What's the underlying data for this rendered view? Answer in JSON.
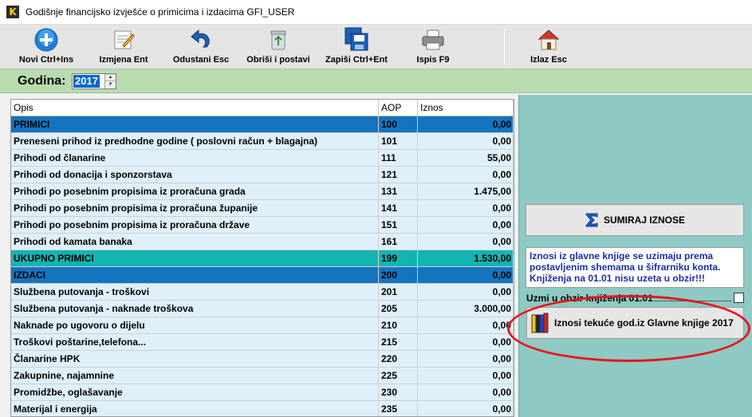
{
  "window": {
    "title": "Godišnje financijsko izvješće o primicima i izdacima GFI_USER",
    "app_icon": "K"
  },
  "toolbar": {
    "new": "Novi Ctrl+Ins",
    "edit": "Izmjena Ent",
    "cancel": "Odustani Esc",
    "delete": "Obriši i postavi",
    "save": "Zapiši Ctrl+Ent",
    "print": "Ispis F9",
    "exit": "Izlaz Esc"
  },
  "year": {
    "label": "Godina:",
    "value": "2017"
  },
  "table": {
    "headers": {
      "opis": "Opis",
      "aop": "AOP",
      "iznos": "Iznos"
    },
    "rows": [
      {
        "opis": "PRIMICI",
        "aop": "100",
        "iznos": "0,00",
        "kind": "section"
      },
      {
        "opis": "Preneseni prihod iz predhodne godine ( poslovni račun + blagajna)",
        "aop": "101",
        "iznos": "0,00",
        "kind": "normal"
      },
      {
        "opis": "Prihodi od članarine",
        "aop": "111",
        "iznos": "55,00",
        "kind": "normal"
      },
      {
        "opis": "Prihodi od donacija i sponzorstava",
        "aop": "121",
        "iznos": "0,00",
        "kind": "normal"
      },
      {
        "opis": "Prihodi po posebnim propisima iz proračuna grada",
        "aop": "131",
        "iznos": "1.475,00",
        "kind": "normal"
      },
      {
        "opis": "Prihodi po posebnim propisima iz proračuna županije",
        "aop": "141",
        "iznos": "0,00",
        "kind": "normal"
      },
      {
        "opis": "Prihodi po posebnim propisima iz proračuna države",
        "aop": "151",
        "iznos": "0,00",
        "kind": "normal"
      },
      {
        "opis": "Prihodi od kamata banaka",
        "aop": "161",
        "iznos": "0,00",
        "kind": "normal"
      },
      {
        "opis": "UKUPNO PRIMICI",
        "aop": "199",
        "iznos": "1.530,00",
        "kind": "total"
      },
      {
        "opis": "IZDACI",
        "aop": "200",
        "iznos": "0,00",
        "kind": "section"
      },
      {
        "opis": "Službena putovanja - troškovi",
        "aop": "201",
        "iznos": "0,00",
        "kind": "normal"
      },
      {
        "opis": "Službena putovanja - naknade troškova",
        "aop": "205",
        "iznos": "3.000,00",
        "kind": "normal"
      },
      {
        "opis": "Naknade po ugovoru o dijelu",
        "aop": "210",
        "iznos": "0,00",
        "kind": "normal"
      },
      {
        "opis": "Troškovi poštarine,telefona...",
        "aop": "215",
        "iznos": "0,00",
        "kind": "normal"
      },
      {
        "opis": "Članarine HPK",
        "aop": "220",
        "iznos": "0,00",
        "kind": "normal"
      },
      {
        "opis": "Zakupnine, najamnine",
        "aop": "225",
        "iznos": "0,00",
        "kind": "normal"
      },
      {
        "opis": "Promidžbe, oglašavanje",
        "aop": "230",
        "iznos": "0,00",
        "kind": "normal"
      },
      {
        "opis": "Materijal i energija",
        "aop": "235",
        "iznos": "0,00",
        "kind": "normal"
      }
    ]
  },
  "panel": {
    "sum_button": "SUMIRAJ IZNOSE",
    "info_text": "Iznosi iz glavne knjige se uzimaju prema postavljenim shemama u šifrarniku konta. Knjiženja na 01.01 nisu uzeta u obzir!!!",
    "checkbox_label": "Uzmi u obzir knjiženja 01.01",
    "checkbox_checked": false,
    "glavna_button": "Iznosi tekuće god.iz Glavne knjige 2017"
  },
  "colors": {
    "section": "#1474bf",
    "total": "#14b4b0",
    "row": "#dff0fa",
    "panel": "#8ec9c3",
    "highlight": "#e8141a"
  }
}
